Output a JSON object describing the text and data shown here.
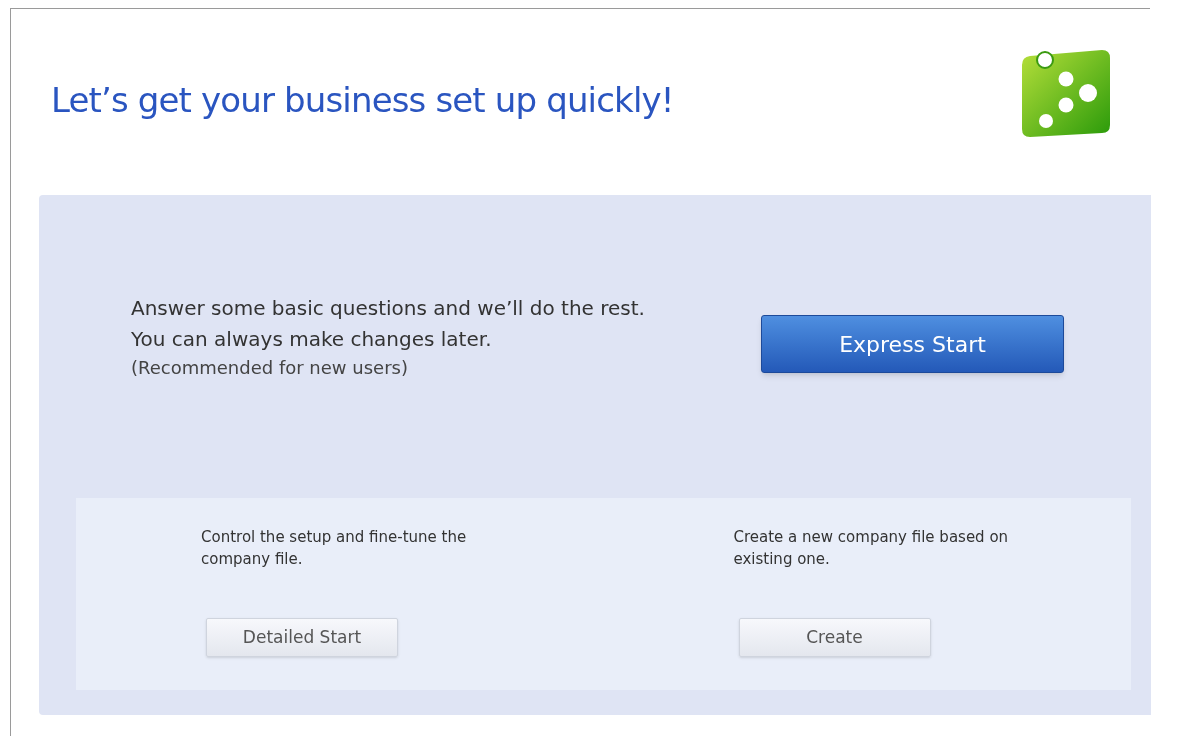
{
  "header": {
    "title": "Let’s get your business set up quickly!"
  },
  "express": {
    "lines": [
      "Answer some basic questions and we’ll do the rest. You can always make changes later."
    ],
    "note": "(Recommended for new users)",
    "button": "Express Start"
  },
  "options": [
    {
      "text": "Control the setup and fine-tune the company file.",
      "button": "Detailed Start"
    },
    {
      "text": "Create a new company file based on existing one.",
      "button": "Create"
    }
  ]
}
